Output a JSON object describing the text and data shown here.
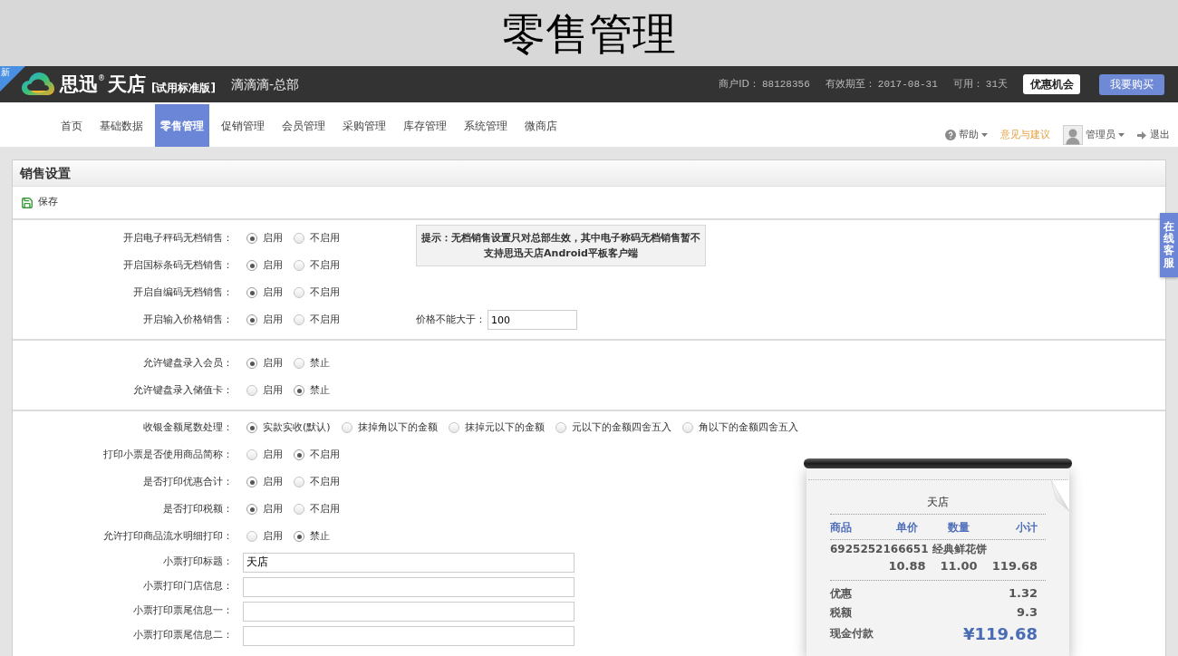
{
  "page_title": "零售管理",
  "header": {
    "badge": "新",
    "brand": "思迅",
    "brand_mark": "®",
    "brand_suffix": "天店",
    "edition": "[试用标准版]",
    "store": "滴滴滴-总部",
    "account_info": [
      {
        "label": "商户ID：",
        "value": "88128356"
      },
      {
        "label": "有效期至：",
        "value": "2017-08-31"
      },
      {
        "label": "可用：",
        "value": "31天"
      }
    ],
    "buttons": [
      {
        "label": "优惠机会",
        "kind": "light"
      },
      {
        "label": "我要购买",
        "kind": "primary"
      }
    ]
  },
  "nav": {
    "tabs": [
      {
        "label": "首页",
        "selected": false
      },
      {
        "label": "基础数据",
        "selected": false
      },
      {
        "label": "零售管理",
        "selected": true
      },
      {
        "label": "促销管理",
        "selected": false
      },
      {
        "label": "会员管理",
        "selected": false
      },
      {
        "label": "采购管理",
        "selected": false
      },
      {
        "label": "库存管理",
        "selected": false
      },
      {
        "label": "系统管理",
        "selected": false
      },
      {
        "label": "微商店",
        "selected": false
      }
    ],
    "tools": [
      {
        "kind": "help",
        "label": "帮助"
      },
      {
        "kind": "feedback",
        "label": "意见与建议"
      },
      {
        "kind": "user",
        "label": "管理员"
      },
      {
        "kind": "logout",
        "label": "退出"
      }
    ]
  },
  "side_tab": "在线客服",
  "panel": {
    "title": "销售设置",
    "save_button": "保存",
    "sections": [
      {
        "rows": [
          {
            "kind": "radio",
            "label": "开启电子秤码无档销售：",
            "options": [
              {
                "label": "启用",
                "selected": true
              },
              {
                "label": "不启用",
                "selected": false
              }
            ]
          },
          {
            "kind": "radio",
            "label": "开启国标条码无档销售：",
            "options": [
              {
                "label": "启用",
                "selected": true
              },
              {
                "label": "不启用",
                "selected": false
              }
            ]
          },
          {
            "kind": "radio",
            "label": "开启自编码无档销售：",
            "options": [
              {
                "label": "启用",
                "selected": true
              },
              {
                "label": "不启用",
                "selected": false
              }
            ]
          },
          {
            "kind": "radio",
            "label": "开启输入价格销售：",
            "options": [
              {
                "label": "启用",
                "selected": true
              },
              {
                "label": "不启用",
                "selected": false
              }
            ]
          }
        ],
        "tip": "提示：无档销售设置只对总部生效，其中电子称码无档销售暂不支持思迅天店Android平板客户端",
        "price_limit": {
          "label": "价格不能大于：",
          "value": "100"
        }
      },
      {
        "rows": [
          {
            "kind": "radio",
            "label": "允许键盘录入会员：",
            "options": [
              {
                "label": "启用",
                "selected": true
              },
              {
                "label": "禁止",
                "selected": false
              }
            ]
          },
          {
            "kind": "radio",
            "label": "允许键盘录入储值卡：",
            "options": [
              {
                "label": "启用",
                "selected": false
              },
              {
                "label": "禁止",
                "selected": true
              }
            ]
          }
        ]
      },
      {
        "rows": [
          {
            "kind": "radio",
            "label": "收银金额尾数处理：",
            "options": [
              {
                "label": "实款实收(默认)",
                "selected": true
              },
              {
                "label": "抹掉角以下的金额",
                "selected": false
              },
              {
                "label": "抹掉元以下的金额",
                "selected": false
              },
              {
                "label": "元以下的金额四舍五入",
                "selected": false
              },
              {
                "label": "角以下的金额四舍五入",
                "selected": false
              }
            ]
          },
          {
            "kind": "radio",
            "label": "打印小票是否使用商品简称：",
            "options": [
              {
                "label": "启用",
                "selected": false
              },
              {
                "label": "不启用",
                "selected": true
              }
            ]
          },
          {
            "kind": "radio",
            "label": "是否打印优惠合计：",
            "options": [
              {
                "label": "启用",
                "selected": true
              },
              {
                "label": "不启用",
                "selected": false
              }
            ]
          },
          {
            "kind": "radio",
            "label": "是否打印税额：",
            "options": [
              {
                "label": "启用",
                "selected": true
              },
              {
                "label": "不启用",
                "selected": false
              }
            ]
          },
          {
            "kind": "radio",
            "label": "允许打印商品流水明细打印：",
            "options": [
              {
                "label": "启用",
                "selected": false
              },
              {
                "label": "禁止",
                "selected": true
              }
            ]
          },
          {
            "kind": "text",
            "label": "小票打印标题：",
            "value": "天店"
          },
          {
            "kind": "text",
            "label": "小票打印门店信息："
          },
          {
            "kind": "text",
            "label": "小票打印票尾信息一："
          },
          {
            "kind": "text",
            "label": "小票打印票尾信息二："
          }
        ],
        "receipt": {
          "title": "天店",
          "columns": [
            "商品",
            "单价",
            "数量",
            "小计"
          ],
          "items": [
            {
              "name": "6925252166651 经典鲜花饼",
              "price": "10.88",
              "quantity": "11.00",
              "subtotal": "119.68"
            }
          ],
          "totals": [
            {
              "kind": "plain",
              "label": "优惠",
              "value": "1.32"
            },
            {
              "kind": "plain",
              "label": "税额",
              "value": "9.3"
            },
            {
              "kind": "grand",
              "label": "现金付款",
              "value": "¥119.68"
            }
          ]
        }
      }
    ]
  }
}
